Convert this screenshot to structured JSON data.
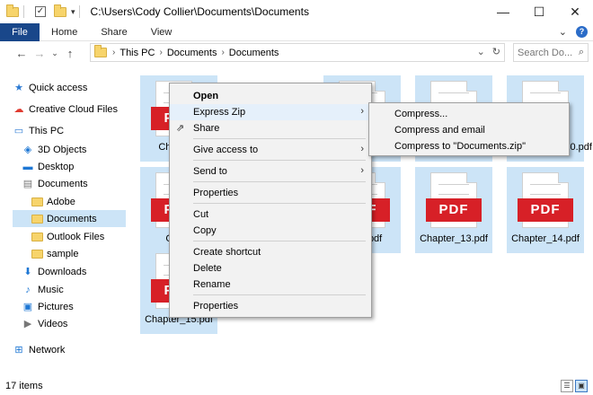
{
  "titlebar": {
    "path": "C:\\Users\\Cody Collier\\Documents\\Documents",
    "minimize": "—",
    "maximize": "☐",
    "close": "✕"
  },
  "ribbon": {
    "tabs": [
      "File",
      "Home",
      "Share",
      "View"
    ],
    "expand": "⌄",
    "help": "?"
  },
  "nav": {
    "back": "←",
    "forward": "→",
    "recent": "⌄",
    "up": "↑"
  },
  "address": {
    "crumbs": [
      "This PC",
      "Documents",
      "Documents"
    ],
    "sep": "›",
    "dropdown": "⌄",
    "refresh": "↻"
  },
  "search": {
    "placeholder": "Search Do...",
    "icon": "search-icon"
  },
  "sidebar": {
    "items": [
      {
        "label": "Quick access",
        "icon": "star-icon"
      },
      {
        "label": "Creative Cloud Files",
        "icon": "creative-cloud-icon"
      },
      {
        "label": "This PC",
        "icon": "computer-icon"
      },
      {
        "label": "3D Objects",
        "icon": "3d-objects-icon"
      },
      {
        "label": "Desktop",
        "icon": "desktop-icon"
      },
      {
        "label": "Documents",
        "icon": "documents-icon"
      },
      {
        "label": "Adobe",
        "icon": "folder-icon"
      },
      {
        "label": "Documents",
        "icon": "folder-icon"
      },
      {
        "label": "Outlook Files",
        "icon": "folder-icon"
      },
      {
        "label": "sample",
        "icon": "folder-icon"
      },
      {
        "label": "Downloads",
        "icon": "downloads-icon"
      },
      {
        "label": "Music",
        "icon": "music-icon"
      },
      {
        "label": "Pictures",
        "icon": "pictures-icon"
      },
      {
        "label": "Videos",
        "icon": "videos-icon"
      },
      {
        "label": "Network",
        "icon": "network-icon"
      }
    ]
  },
  "files": {
    "badge": "PDF",
    "tiles": [
      {
        "label": "Chapter_"
      },
      {
        "label": ""
      },
      {
        "label": ""
      },
      {
        "label": ""
      },
      {
        "label": "Chapter_10.pdf"
      },
      {
        "label": "Chapt"
      },
      {
        "label": "2.pdf"
      },
      {
        "label": "Chapter_13.pdf"
      },
      {
        "label": "Chapter_14.pdf"
      },
      {
        "label": "Chapter_15.pdf"
      }
    ]
  },
  "context_menu": {
    "open": "Open",
    "express_zip": "Express Zip",
    "share": "Share",
    "give_access": "Give access to",
    "send_to": "Send to",
    "properties_top": "Properties",
    "cut": "Cut",
    "copy": "Copy",
    "create_shortcut": "Create shortcut",
    "delete": "Delete",
    "rename": "Rename",
    "properties": "Properties",
    "arrow": "›"
  },
  "submenu": {
    "compress": "Compress...",
    "compress_email": "Compress and email",
    "compress_to": "Compress to \"Documents.zip\""
  },
  "status": {
    "count": "17 items"
  },
  "colors": {
    "file_tab": "#19478a",
    "selection": "#cce4f7",
    "pdf_red": "#d72027"
  }
}
